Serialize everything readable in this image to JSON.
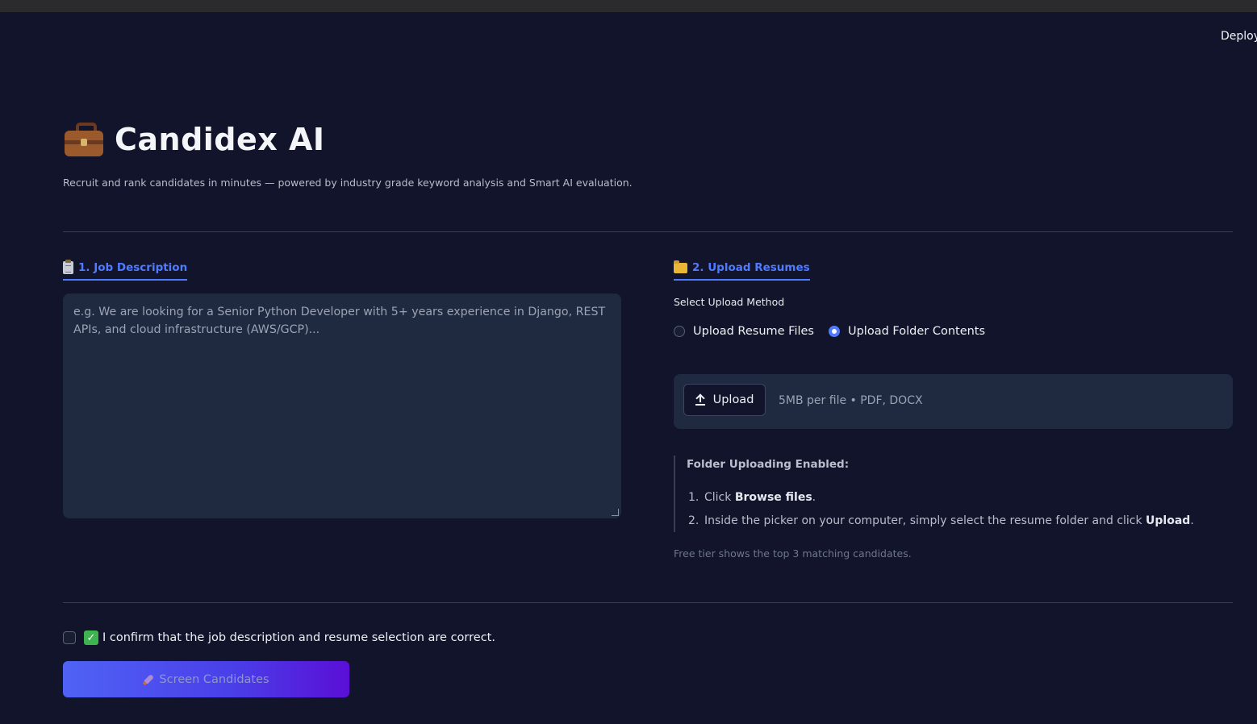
{
  "toolbar": {
    "deploy_label": "Deploy"
  },
  "header": {
    "title": "Candidex AI",
    "subtitle": "Recruit and rank candidates in minutes — powered by industry grade keyword analysis and Smart AI evaluation."
  },
  "job_description": {
    "heading": "1. Job Description",
    "placeholder": "e.g. We are looking for a Senior Python Developer with 5+ years experience in Django, REST APIs, and cloud infrastructure (AWS/GCP)..."
  },
  "upload": {
    "heading": "2. Upload Resumes",
    "method_label": "Select Upload Method",
    "options": [
      {
        "label": "Upload Resume Files",
        "selected": false
      },
      {
        "label": "Upload Folder Contents",
        "selected": true
      }
    ],
    "button_label": "Upload",
    "hint": "5MB per file • PDF, DOCX",
    "info": {
      "title": "Folder Uploading Enabled:",
      "step1_num": "1.",
      "step1_pre": "Click ",
      "step1_bold": "Browse files",
      "step1_post": ".",
      "step2_num": "2.",
      "step2_pre": "Inside the picker on your computer, simply select the resume folder and click ",
      "step2_bold": "Upload",
      "step2_post": "."
    },
    "free_tier_note": "Free tier shows the top 3 matching candidates."
  },
  "confirm": {
    "label": "I confirm that the job description and resume selection are correct.",
    "checked": false
  },
  "action": {
    "screen_label": "Screen Candidates"
  },
  "colors": {
    "background": "#11142a",
    "panel": "#1f2940",
    "accent": "#4f7bff",
    "button_gradient_start": "#4f63f5",
    "button_gradient_end": "#5a0fd6"
  },
  "icons": {
    "title": "briefcase-icon",
    "job_description": "clipboard-icon",
    "upload": "folder-icon",
    "upload_button": "upload-icon",
    "confirm": "check-mark-icon",
    "screen": "rocket-icon"
  }
}
